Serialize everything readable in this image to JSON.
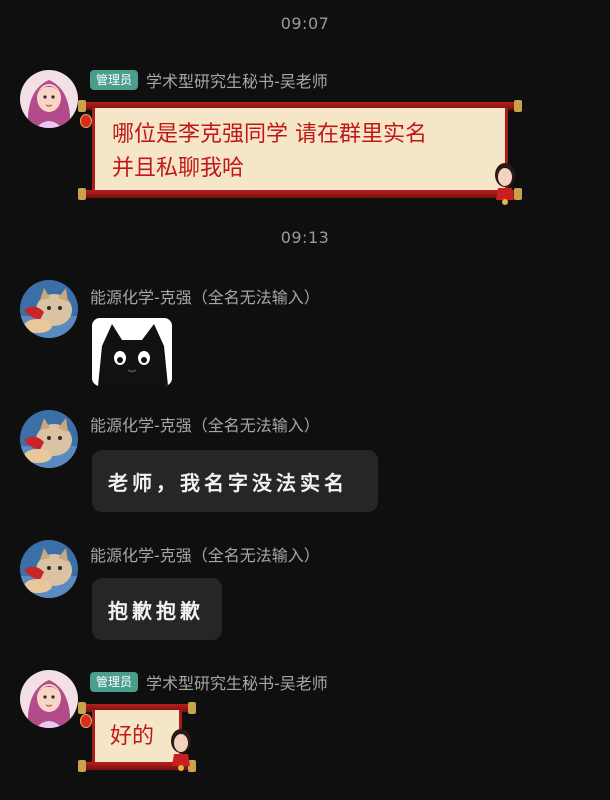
{
  "timestamps": [
    "09:07",
    "09:13"
  ],
  "messages": [
    {
      "badge": "管理员",
      "sender": "学术型研究生秘书-吴老师",
      "lines": [
        "哪位是李克强同学 请在群里实名",
        "并且私聊我哈"
      ]
    },
    {
      "sender": "能源化学-克强（全名无法输入）",
      "sticker": "black-cat-sticker"
    },
    {
      "sender": "能源化学-克强（全名无法输入）",
      "text": "老师，我名字没法实名"
    },
    {
      "sender": "能源化学-克强（全名无法输入）",
      "text": "抱歉抱歉"
    },
    {
      "badge": "管理员",
      "sender": "学术型研究生秘书-吴老师",
      "text": "好的"
    }
  ],
  "colors": {
    "background": "#0f0f10",
    "badge": "#4a9e8c",
    "scroll_paper": "#f6e6c8",
    "scroll_text": "#c01818",
    "dark_bubble": "#262628"
  }
}
